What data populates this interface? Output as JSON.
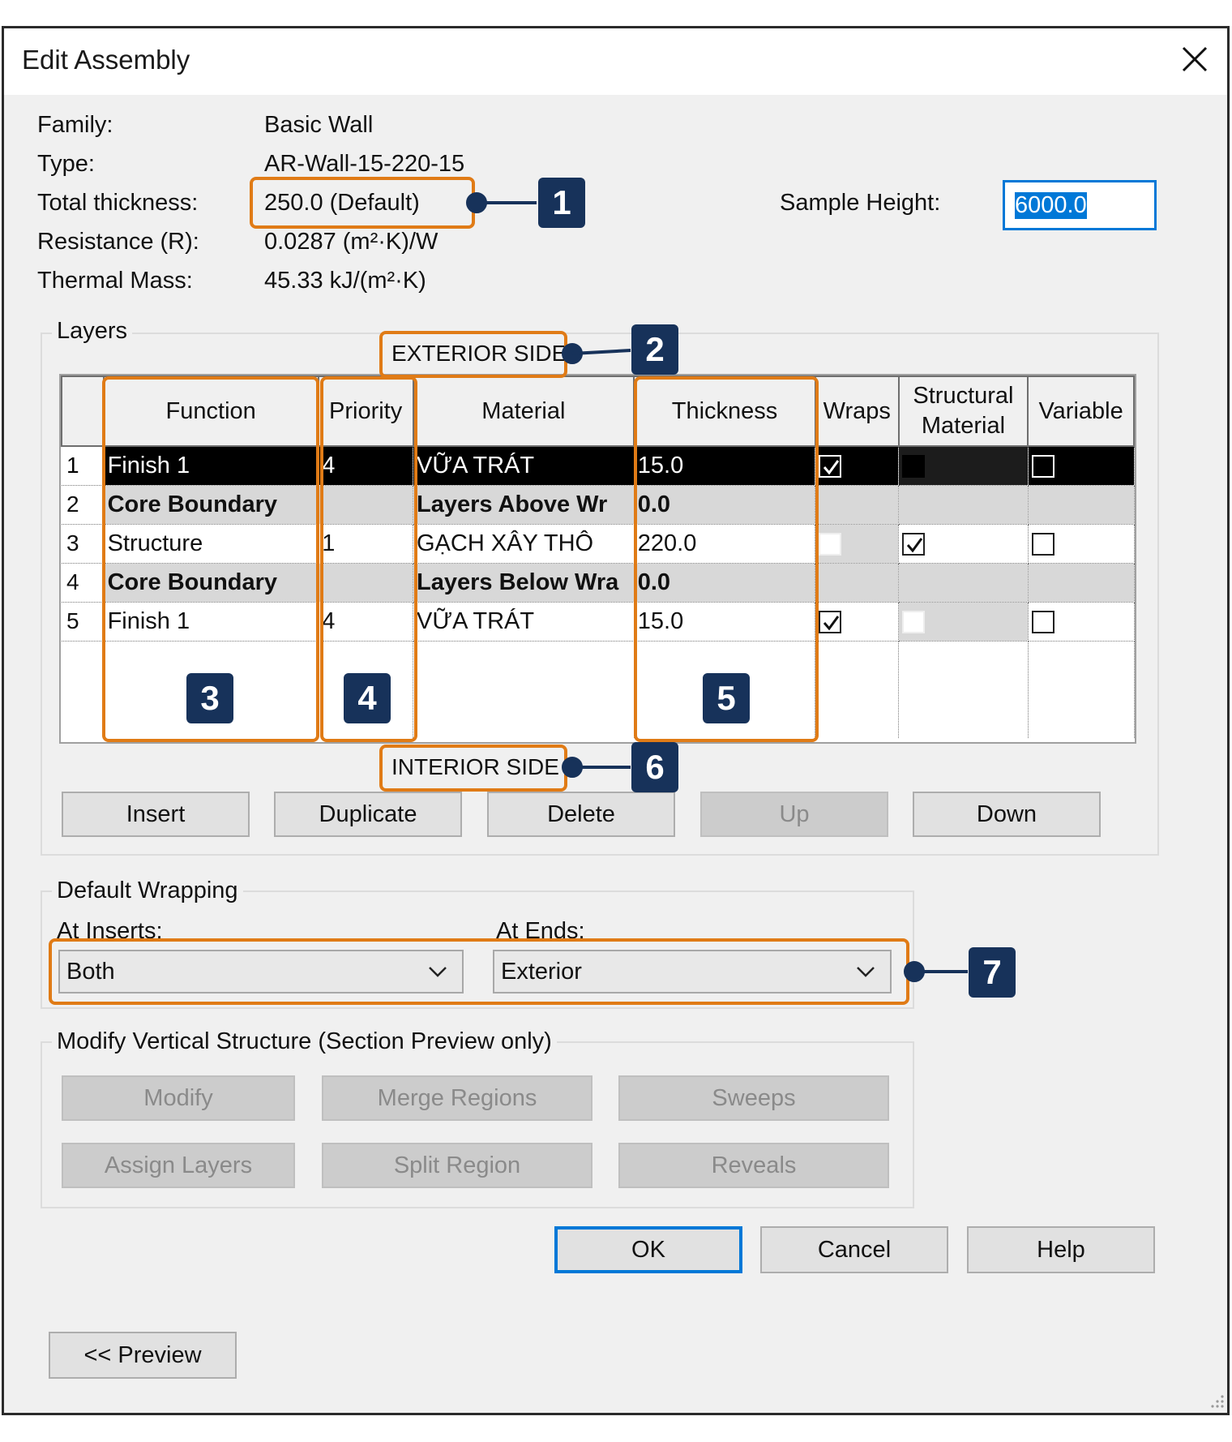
{
  "window": {
    "title": "Edit Assembly"
  },
  "info": {
    "family_label": "Family:",
    "family_value": "Basic Wall",
    "type_label": "Type:",
    "type_value": "AR-Wall-15-220-15",
    "thickness_label": "Total thickness:",
    "thickness_value": "250.0 (Default)",
    "resistance_label": "Resistance (R):",
    "resistance_value": "0.0287 (m²·K)/W",
    "thermal_label": "Thermal Mass:",
    "thermal_value": "45.33 kJ/(m²·K)",
    "sample_height_label": "Sample Height:",
    "sample_height_value": "6000.0"
  },
  "layers": {
    "group_title": "Layers",
    "exterior_label": "EXTERIOR SIDE",
    "interior_label": "INTERIOR SIDE",
    "columns": [
      "Function",
      "Priority",
      "Material",
      "Thickness",
      "Wraps",
      "Structural Material",
      "Variable"
    ],
    "column_material_line1": "Structural",
    "column_material_line2": "Material",
    "rows": [
      {
        "num": "1",
        "function": "Finish 1",
        "priority": "4",
        "material": "VỮA TRÁT",
        "thickness": "15.0",
        "wraps": true,
        "structural": false,
        "variable": false
      },
      {
        "num": "2",
        "function": "Core Boundary",
        "priority": "",
        "material": "Layers Above Wr",
        "thickness": "0.0"
      },
      {
        "num": "3",
        "function": "Structure",
        "priority": "1",
        "material": "GẠCH XÂY THÔ",
        "thickness": "220.0",
        "wraps": false,
        "structural": true,
        "variable": false
      },
      {
        "num": "4",
        "function": "Core Boundary",
        "priority": "",
        "material": "Layers Below Wra",
        "thickness": "0.0"
      },
      {
        "num": "5",
        "function": "Finish 1",
        "priority": "4",
        "material": "VỮA TRÁT",
        "thickness": "15.0",
        "wraps": true,
        "structural": false,
        "variable": false
      }
    ],
    "buttons": {
      "insert": "Insert",
      "duplicate": "Duplicate",
      "delete": "Delete",
      "up": "Up",
      "down": "Down"
    }
  },
  "wrapping": {
    "group_title": "Default Wrapping",
    "inserts_label": "At Inserts:",
    "inserts_value": "Both",
    "ends_label": "At Ends:",
    "ends_value": "Exterior"
  },
  "vertical": {
    "group_title": "Modify Vertical Structure (Section Preview only)",
    "modify": "Modify",
    "merge": "Merge Regions",
    "sweeps": "Sweeps",
    "assign": "Assign Layers",
    "split": "Split Region",
    "reveals": "Reveals"
  },
  "footer": {
    "ok": "OK",
    "cancel": "Cancel",
    "help": "Help",
    "preview": "<< Preview"
  },
  "callouts": [
    "1",
    "2",
    "3",
    "4",
    "5",
    "6",
    "7"
  ],
  "colors": {
    "callout_border": "#e07b16",
    "callout_badge": "#17325a",
    "selection": "#000000",
    "focus": "#0078d7"
  }
}
